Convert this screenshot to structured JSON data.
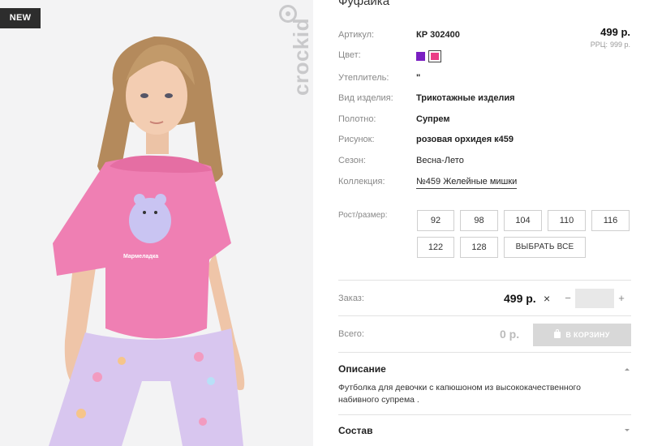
{
  "badge": "NEW",
  "brand": "crockid",
  "product": {
    "title": "Фуфайка",
    "price": "499 р.",
    "rrp_label": "РРЦ:",
    "rrp_value": "999 р."
  },
  "colors": {
    "page_bg": "#ffffff",
    "photo_bg": "#f3f3f4",
    "swatch_1": "#7a1fc2",
    "swatch_2": "#ea3d86",
    "shirt": "#ef7fb3",
    "pants": "#d8c6ef",
    "cart_button": "#d8d8d8"
  },
  "details": [
    {
      "label": "Артикул:",
      "value": "КР 302400"
    },
    {
      "label": "Цвет:",
      "value": ""
    },
    {
      "label": "Утеплитель:",
      "value": "\""
    },
    {
      "label": "Вид изделия:",
      "value": "Трикотажные изделия"
    },
    {
      "label": "Полотно:",
      "value": "Супрем"
    },
    {
      "label": "Рисунок:",
      "value": "розовая орхидея к459"
    },
    {
      "label": "Сезон:",
      "value": "Весна-Лето"
    },
    {
      "label": "Коллекция:",
      "value": "№459 Желейные мишки"
    }
  ],
  "sizes": {
    "label": "Рост/размер:",
    "options": [
      "92",
      "98",
      "104",
      "110",
      "116",
      "122",
      "128"
    ],
    "select_all": "ВЫБРАТЬ ВСЕ"
  },
  "order": {
    "label": "Заказ:",
    "price": "499 р.",
    "times": "×",
    "minus": "−",
    "plus": "+",
    "quantity": ""
  },
  "total": {
    "label": "Всего:",
    "value": "0 р.",
    "cart_button": "В КОРЗИНУ"
  },
  "sections": {
    "description_title": "Описание",
    "description_text": "Футболка для девочки с капюшоном из высококачественного набивного супрема .",
    "composition_title": "Состав"
  },
  "icons": [
    "shopping-bag-icon",
    "chevron-up-icon",
    "chevron-down-icon",
    "close-icon",
    "crockid-logo-icon"
  ]
}
